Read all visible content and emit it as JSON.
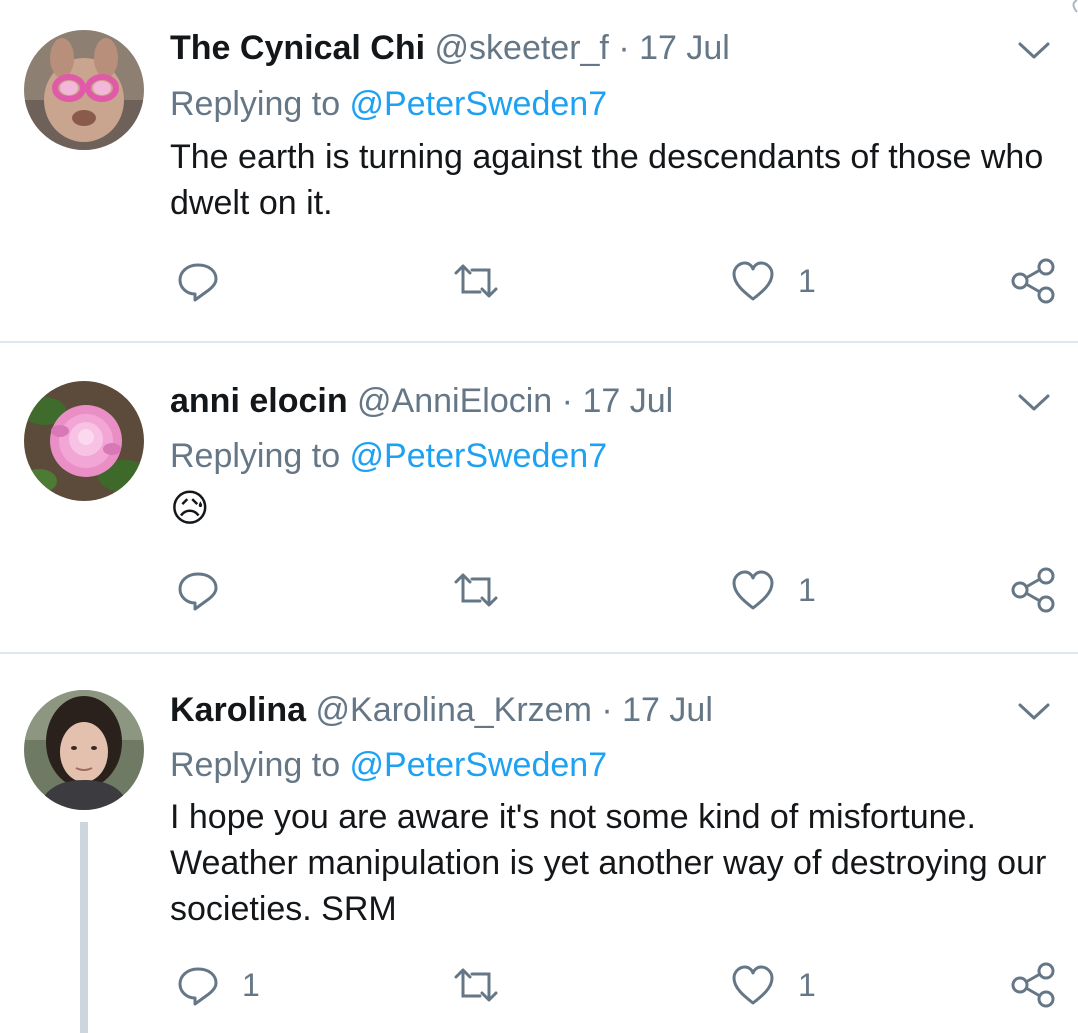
{
  "tweets": [
    {
      "name": "The Cynical Chi",
      "handle": "@skeeter_f",
      "separator": "·",
      "date": "17 Jul",
      "replying_prefix": "Replying to ",
      "replying_to": "@PeterSweden7",
      "text": "The earth is turning against the descendants of those who dwelt on it.",
      "reply_count": "",
      "retweet_count": "",
      "like_count": "1"
    },
    {
      "name": "anni elocin",
      "handle": "@AnniElocin",
      "separator": "·",
      "date": "17 Jul",
      "replying_prefix": "Replying to ",
      "replying_to": "@PeterSweden7",
      "text": "😥",
      "reply_count": "",
      "retweet_count": "",
      "like_count": "1"
    },
    {
      "name": "Karolina",
      "handle": "@Karolina_Krzem",
      "separator": "·",
      "date": "17 Jul",
      "replying_prefix": "Replying to ",
      "replying_to": "@PeterSweden7",
      "text": "I hope you are aware it's not some kind of misfortune. Weather manipulation is yet another way of destroying our societies. SRM",
      "reply_count": "1",
      "retweet_count": "",
      "like_count": "1"
    }
  ],
  "icons": {
    "avatar": "avatar",
    "chevron": "chevron-down-icon",
    "reply": "reply-icon",
    "retweet": "retweet-icon",
    "like": "heart-icon",
    "share": "share-icon"
  },
  "colors": {
    "name": "#14171a",
    "secondary": "#657786",
    "mention": "#1da1f2",
    "divider": "#e1e8ed",
    "thread_line": "#ccd6dd"
  }
}
